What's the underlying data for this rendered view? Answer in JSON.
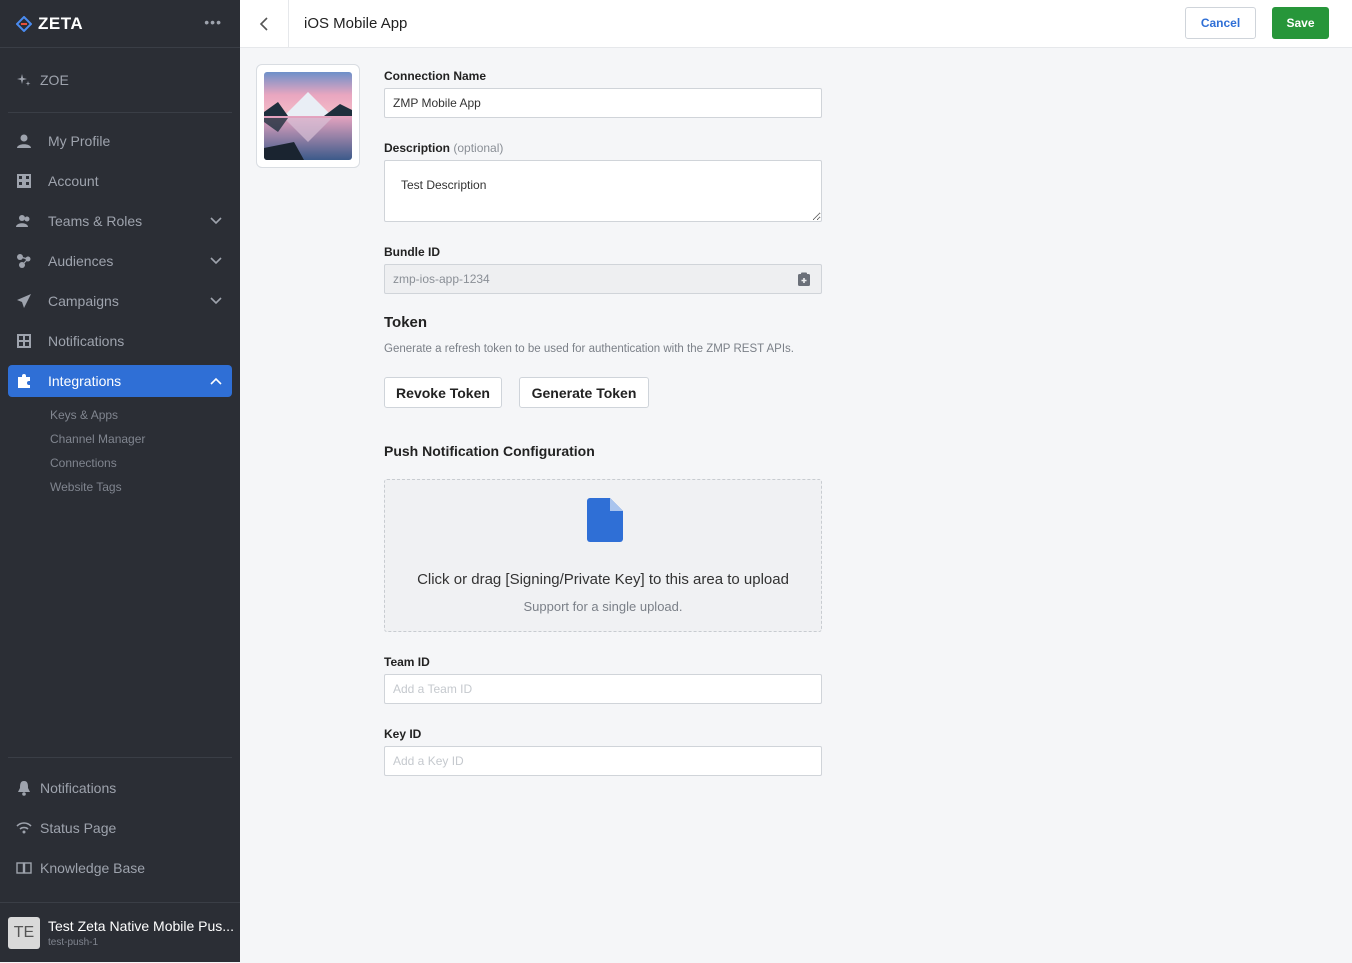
{
  "brand": {
    "name": "ZETA",
    "menu_icon": "ellipsis-icon"
  },
  "sidebar": {
    "zoe": "ZOE",
    "items": [
      {
        "label": "My Profile",
        "icon": "user-icon"
      },
      {
        "label": "Account",
        "icon": "building-icon"
      },
      {
        "label": "Teams & Roles",
        "icon": "users-icon"
      },
      {
        "label": "Audiences",
        "icon": "audiences-icon"
      },
      {
        "label": "Campaigns",
        "icon": "paper-plane-icon"
      },
      {
        "label": "Notifications",
        "icon": "grid-icon"
      },
      {
        "label": "Integrations",
        "icon": "puzzle-icon"
      }
    ],
    "integrations_sub": [
      "Keys & Apps",
      "Channel Manager",
      "Connections",
      "Website Tags"
    ],
    "bottom": [
      {
        "label": "Notifications",
        "icon": "bell-icon"
      },
      {
        "label": "Status Page",
        "icon": "wifi-icon"
      },
      {
        "label": "Knowledge Base",
        "icon": "book-icon"
      }
    ],
    "account": {
      "initials": "TE",
      "name": "Test Zeta Native Mobile Pus...",
      "sub": "test-push-1"
    }
  },
  "header": {
    "title": "iOS Mobile App",
    "cancel": "Cancel",
    "save": "Save"
  },
  "form": {
    "connection_name_label": "Connection Name",
    "connection_name_value": "ZMP Mobile App",
    "description_label": "Description",
    "description_optional": "(optional)",
    "description_value": "Test Description",
    "bundle_label": "Bundle ID",
    "bundle_value": "zmp-ios-app-1234",
    "token_heading": "Token",
    "token_desc": "Generate a refresh token to be used for authentication with the ZMP REST APIs.",
    "revoke": "Revoke Token",
    "generate": "Generate Token",
    "push_heading": "Push Notification Configuration",
    "upload_main": "Click or drag [Signing/Private Key] to this area to upload",
    "upload_sub": "Support for a single upload.",
    "team_label": "Team ID",
    "team_placeholder": "Add a Team ID",
    "key_label": "Key ID",
    "key_placeholder": "Add a Key ID"
  },
  "colors": {
    "sidebar": "#2b2e35",
    "accent": "#2f6fd6",
    "save": "#27963a"
  }
}
